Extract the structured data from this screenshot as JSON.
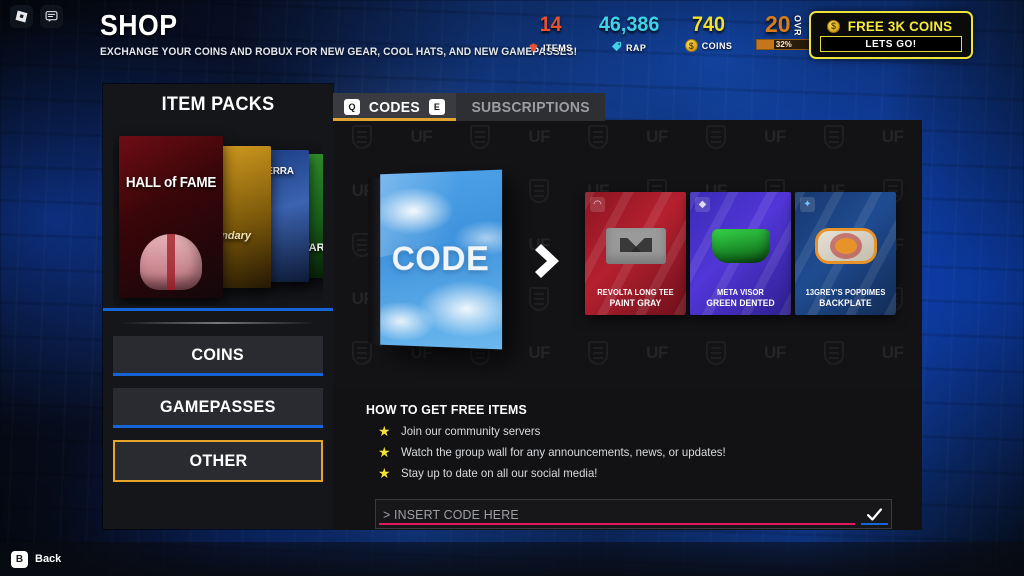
{
  "header": {
    "title": "SHOP",
    "subtitle": "EXCHANGE YOUR COINS AND ROBUX FOR NEW GEAR, COOL HATS, AND NEW GAMEPASSES!",
    "roblox_icon": "roblox-logo-icon",
    "chat_icon": "chat-icon"
  },
  "stats": [
    {
      "value": "14",
      "label": "ITEMS",
      "icon": "shirt-icon",
      "color": "#e8512d"
    },
    {
      "value": "46,386",
      "label": "RAP",
      "icon": "tag-icon",
      "color": "#3fd2e8"
    },
    {
      "value": "740",
      "label": "COINS",
      "icon": "coin-icon",
      "color": "#f2e02e"
    }
  ],
  "ovr": {
    "value": "20",
    "label": "OVR",
    "progress_text": "32%",
    "progress_pct": 32,
    "color": "#d97d1a"
  },
  "free_coins": {
    "title": "FREE 3K COINS",
    "button_label": "LETS GO!",
    "coin_icon": "coin-icon",
    "border_color": "#ece23a"
  },
  "sidebar": {
    "title": "ITEM PACKS",
    "packs": [
      {
        "name": "HALL of FAME"
      },
      {
        "name": "endary"
      },
      {
        "name": "ERRA"
      },
      {
        "name": "STAR"
      }
    ],
    "categories": [
      {
        "label": "COINS",
        "selected": false
      },
      {
        "label": "GAMEPASSES",
        "selected": false
      },
      {
        "label": "OTHER",
        "selected": true
      }
    ]
  },
  "tabs": [
    {
      "label": "CODES",
      "key_left": "Q",
      "key_right": "E",
      "active": true
    },
    {
      "label": "SUBSCRIPTIONS",
      "active": false
    }
  ],
  "showcase": {
    "code_box_label": "CODE",
    "arrow_icon": "chevron-right-icon",
    "items": [
      {
        "name_line1": "REVOLTA LONG TEE",
        "name_line2": "PAINT GRAY",
        "rarity_icon": "swirl-icon",
        "color": "#b5202f"
      },
      {
        "name_line1": "META VISOR",
        "name_line2": "GREEN DENTED",
        "rarity_icon": "shield-icon",
        "color": "#5236d8"
      },
      {
        "name_line1": "13GREY'S POPDIMES",
        "name_line2": "BACKPLATE",
        "rarity_icon": "star-icon",
        "color": "#1f4c91"
      }
    ]
  },
  "howto": {
    "title": "HOW TO GET FREE ITEMS",
    "bullets": [
      "Join our community servers",
      "Watch the group wall for any announcements, news, or updates!",
      "Stay up to date on all our social media!"
    ]
  },
  "code_input": {
    "placeholder": "> INSERT CODE HERE",
    "value": "",
    "submit_icon": "check-icon",
    "underline_color": "#e2175f"
  },
  "bottom": {
    "back_key": "B",
    "back_label": "Back"
  },
  "watermark": {
    "text": "UF",
    "shield_icon": "nfl-shield-icon"
  }
}
